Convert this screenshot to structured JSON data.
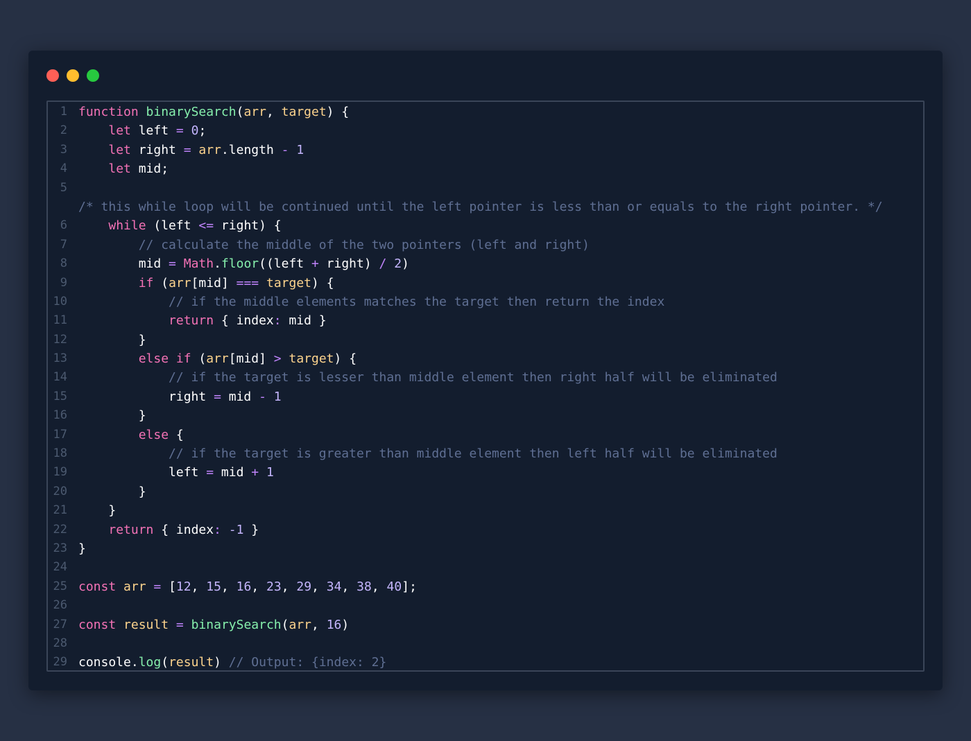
{
  "editor": {
    "window_dots": [
      {
        "name": "close",
        "color": "#ff5f56"
      },
      {
        "name": "minimize",
        "color": "#ffbd2e"
      },
      {
        "name": "maximize",
        "color": "#27c93f"
      }
    ],
    "colors": {
      "background": "#263044",
      "window": "#131d2e",
      "keyword": "#f472b6",
      "function": "#86efac",
      "parameter": "#fcd38d",
      "number": "#c4b5fd",
      "operator": "#c084fc",
      "comment": "#5f6f93",
      "plain": "#ffffff",
      "line_number": "#4c5a70"
    },
    "lines": [
      {
        "num": "1",
        "tokens": [
          {
            "t": "function",
            "c": "keyword"
          },
          {
            "t": " ",
            "c": "plain"
          },
          {
            "t": "binarySearch",
            "c": "function"
          },
          {
            "t": "(",
            "c": "plain"
          },
          {
            "t": "arr",
            "c": "parameter"
          },
          {
            "t": ", ",
            "c": "plain"
          },
          {
            "t": "target",
            "c": "parameter"
          },
          {
            "t": ") {",
            "c": "plain"
          }
        ]
      },
      {
        "num": "2",
        "tokens": [
          {
            "t": "    ",
            "c": "plain"
          },
          {
            "t": "let",
            "c": "keyword"
          },
          {
            "t": " left ",
            "c": "plain"
          },
          {
            "t": "=",
            "c": "operator"
          },
          {
            "t": " ",
            "c": "plain"
          },
          {
            "t": "0",
            "c": "number"
          },
          {
            "t": ";",
            "c": "plain"
          }
        ]
      },
      {
        "num": "3",
        "tokens": [
          {
            "t": "    ",
            "c": "plain"
          },
          {
            "t": "let",
            "c": "keyword"
          },
          {
            "t": " right ",
            "c": "plain"
          },
          {
            "t": "=",
            "c": "operator"
          },
          {
            "t": " ",
            "c": "plain"
          },
          {
            "t": "arr",
            "c": "parameter"
          },
          {
            "t": ".length ",
            "c": "plain"
          },
          {
            "t": "-",
            "c": "operator"
          },
          {
            "t": " ",
            "c": "plain"
          },
          {
            "t": "1",
            "c": "number"
          }
        ]
      },
      {
        "num": "4",
        "tokens": [
          {
            "t": "    ",
            "c": "plain"
          },
          {
            "t": "let",
            "c": "keyword"
          },
          {
            "t": " mid;",
            "c": "plain"
          }
        ]
      },
      {
        "num": "5",
        "tokens": []
      },
      {
        "num": "",
        "tokens": [
          {
            "t": "/* this while loop will be continued until the left pointer is less than or equals to the right pointer. */",
            "c": "comment"
          }
        ]
      },
      {
        "num": "6",
        "tokens": [
          {
            "t": "    ",
            "c": "plain"
          },
          {
            "t": "while",
            "c": "keyword"
          },
          {
            "t": " (left ",
            "c": "plain"
          },
          {
            "t": "<=",
            "c": "operator"
          },
          {
            "t": " right) {",
            "c": "plain"
          }
        ]
      },
      {
        "num": "7",
        "tokens": [
          {
            "t": "        ",
            "c": "plain"
          },
          {
            "t": "// calculate the middle of the two pointers (left and right)",
            "c": "comment"
          }
        ]
      },
      {
        "num": "8",
        "tokens": [
          {
            "t": "        mid ",
            "c": "plain"
          },
          {
            "t": "=",
            "c": "operator"
          },
          {
            "t": " ",
            "c": "plain"
          },
          {
            "t": "Math",
            "c": "keyword"
          },
          {
            "t": ".",
            "c": "plain"
          },
          {
            "t": "floor",
            "c": "function"
          },
          {
            "t": "((left ",
            "c": "plain"
          },
          {
            "t": "+",
            "c": "operator"
          },
          {
            "t": " right) ",
            "c": "plain"
          },
          {
            "t": "/",
            "c": "operator"
          },
          {
            "t": " ",
            "c": "plain"
          },
          {
            "t": "2",
            "c": "number"
          },
          {
            "t": ")",
            "c": "plain"
          }
        ]
      },
      {
        "num": "9",
        "tokens": [
          {
            "t": "        ",
            "c": "plain"
          },
          {
            "t": "if",
            "c": "keyword"
          },
          {
            "t": " (",
            "c": "plain"
          },
          {
            "t": "arr",
            "c": "parameter"
          },
          {
            "t": "[mid] ",
            "c": "plain"
          },
          {
            "t": "===",
            "c": "operator"
          },
          {
            "t": " ",
            "c": "plain"
          },
          {
            "t": "target",
            "c": "parameter"
          },
          {
            "t": ") {",
            "c": "plain"
          }
        ]
      },
      {
        "num": "10",
        "tokens": [
          {
            "t": "            ",
            "c": "plain"
          },
          {
            "t": "// if the middle elements matches the target then return the index",
            "c": "comment"
          }
        ]
      },
      {
        "num": "11",
        "tokens": [
          {
            "t": "            ",
            "c": "plain"
          },
          {
            "t": "return",
            "c": "keyword"
          },
          {
            "t": " { index",
            "c": "plain"
          },
          {
            "t": ":",
            "c": "operator"
          },
          {
            "t": " mid }",
            "c": "plain"
          }
        ]
      },
      {
        "num": "12",
        "tokens": [
          {
            "t": "        }",
            "c": "plain"
          }
        ]
      },
      {
        "num": "13",
        "tokens": [
          {
            "t": "        ",
            "c": "plain"
          },
          {
            "t": "else if",
            "c": "keyword"
          },
          {
            "t": " (",
            "c": "plain"
          },
          {
            "t": "arr",
            "c": "parameter"
          },
          {
            "t": "[mid] ",
            "c": "plain"
          },
          {
            "t": ">",
            "c": "operator"
          },
          {
            "t": " ",
            "c": "plain"
          },
          {
            "t": "target",
            "c": "parameter"
          },
          {
            "t": ") {",
            "c": "plain"
          }
        ]
      },
      {
        "num": "14",
        "tokens": [
          {
            "t": "            ",
            "c": "plain"
          },
          {
            "t": "// if the target is lesser than middle element then right half will be eliminated",
            "c": "comment"
          }
        ]
      },
      {
        "num": "15",
        "tokens": [
          {
            "t": "            right ",
            "c": "plain"
          },
          {
            "t": "=",
            "c": "operator"
          },
          {
            "t": " mid ",
            "c": "plain"
          },
          {
            "t": "-",
            "c": "operator"
          },
          {
            "t": " ",
            "c": "plain"
          },
          {
            "t": "1",
            "c": "number"
          }
        ]
      },
      {
        "num": "16",
        "tokens": [
          {
            "t": "        }",
            "c": "plain"
          }
        ]
      },
      {
        "num": "17",
        "tokens": [
          {
            "t": "        ",
            "c": "plain"
          },
          {
            "t": "else",
            "c": "keyword"
          },
          {
            "t": " {",
            "c": "plain"
          }
        ]
      },
      {
        "num": "18",
        "tokens": [
          {
            "t": "            ",
            "c": "plain"
          },
          {
            "t": "// if the target is greater than middle element then left half will be eliminated",
            "c": "comment"
          }
        ]
      },
      {
        "num": "19",
        "tokens": [
          {
            "t": "            left ",
            "c": "plain"
          },
          {
            "t": "=",
            "c": "operator"
          },
          {
            "t": " mid ",
            "c": "plain"
          },
          {
            "t": "+",
            "c": "operator"
          },
          {
            "t": " ",
            "c": "plain"
          },
          {
            "t": "1",
            "c": "number"
          }
        ]
      },
      {
        "num": "20",
        "tokens": [
          {
            "t": "        }",
            "c": "plain"
          }
        ]
      },
      {
        "num": "21",
        "tokens": [
          {
            "t": "    }",
            "c": "plain"
          }
        ]
      },
      {
        "num": "22",
        "tokens": [
          {
            "t": "    ",
            "c": "plain"
          },
          {
            "t": "return",
            "c": "keyword"
          },
          {
            "t": " { index",
            "c": "plain"
          },
          {
            "t": ":",
            "c": "operator"
          },
          {
            "t": " ",
            "c": "plain"
          },
          {
            "t": "-1",
            "c": "number"
          },
          {
            "t": " }",
            "c": "plain"
          }
        ]
      },
      {
        "num": "23",
        "tokens": [
          {
            "t": "}",
            "c": "plain"
          }
        ]
      },
      {
        "num": "24",
        "tokens": []
      },
      {
        "num": "25",
        "tokens": [
          {
            "t": "const",
            "c": "keyword"
          },
          {
            "t": " ",
            "c": "plain"
          },
          {
            "t": "arr",
            "c": "parameter"
          },
          {
            "t": " ",
            "c": "plain"
          },
          {
            "t": "=",
            "c": "operator"
          },
          {
            "t": " [",
            "c": "plain"
          },
          {
            "t": "12",
            "c": "number"
          },
          {
            "t": ", ",
            "c": "plain"
          },
          {
            "t": "15",
            "c": "number"
          },
          {
            "t": ", ",
            "c": "plain"
          },
          {
            "t": "16",
            "c": "number"
          },
          {
            "t": ", ",
            "c": "plain"
          },
          {
            "t": "23",
            "c": "number"
          },
          {
            "t": ", ",
            "c": "plain"
          },
          {
            "t": "29",
            "c": "number"
          },
          {
            "t": ", ",
            "c": "plain"
          },
          {
            "t": "34",
            "c": "number"
          },
          {
            "t": ", ",
            "c": "plain"
          },
          {
            "t": "38",
            "c": "number"
          },
          {
            "t": ", ",
            "c": "plain"
          },
          {
            "t": "40",
            "c": "number"
          },
          {
            "t": "];",
            "c": "plain"
          }
        ]
      },
      {
        "num": "26",
        "tokens": []
      },
      {
        "num": "27",
        "tokens": [
          {
            "t": "const",
            "c": "keyword"
          },
          {
            "t": " ",
            "c": "plain"
          },
          {
            "t": "result",
            "c": "parameter"
          },
          {
            "t": " ",
            "c": "plain"
          },
          {
            "t": "=",
            "c": "operator"
          },
          {
            "t": " ",
            "c": "plain"
          },
          {
            "t": "binarySearch",
            "c": "function"
          },
          {
            "t": "(",
            "c": "plain"
          },
          {
            "t": "arr",
            "c": "parameter"
          },
          {
            "t": ", ",
            "c": "plain"
          },
          {
            "t": "16",
            "c": "number"
          },
          {
            "t": ")",
            "c": "plain"
          }
        ]
      },
      {
        "num": "28",
        "tokens": []
      },
      {
        "num": "29",
        "tokens": [
          {
            "t": "console",
            "c": "plain"
          },
          {
            "t": ".",
            "c": "plain"
          },
          {
            "t": "log",
            "c": "function"
          },
          {
            "t": "(",
            "c": "plain"
          },
          {
            "t": "result",
            "c": "parameter"
          },
          {
            "t": ") ",
            "c": "plain"
          },
          {
            "t": "// Output: {index: 2}",
            "c": "comment"
          }
        ]
      }
    ]
  }
}
